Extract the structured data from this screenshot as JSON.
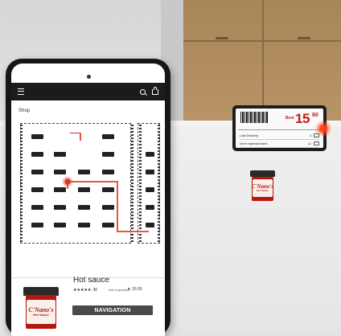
{
  "app": {
    "section_title": "Shop"
  },
  "product": {
    "name": "Hot sauce",
    "rating_stars": "★★★★★",
    "rating_count": "30",
    "ask_link": "Ask a question",
    "likes_icon": "heart-icon",
    "likes_count": "20.00",
    "navigation_button": "NAVIGATION",
    "jar_brand": "C'Nano's",
    "jar_subtitle": "Hot Sauce"
  },
  "shelf_label": {
    "price_prefix": "Best",
    "price": "15",
    "price_suffix": "60",
    "rows": [
      {
        "label": "Last Delivery",
        "value": "4"
      },
      {
        "label": "Next replenishment",
        "value": "12"
      }
    ]
  },
  "colors": {
    "accent_red": "#c21b1b",
    "button_gray": "#4a4a4a",
    "topbar": "#1b1b1b"
  }
}
